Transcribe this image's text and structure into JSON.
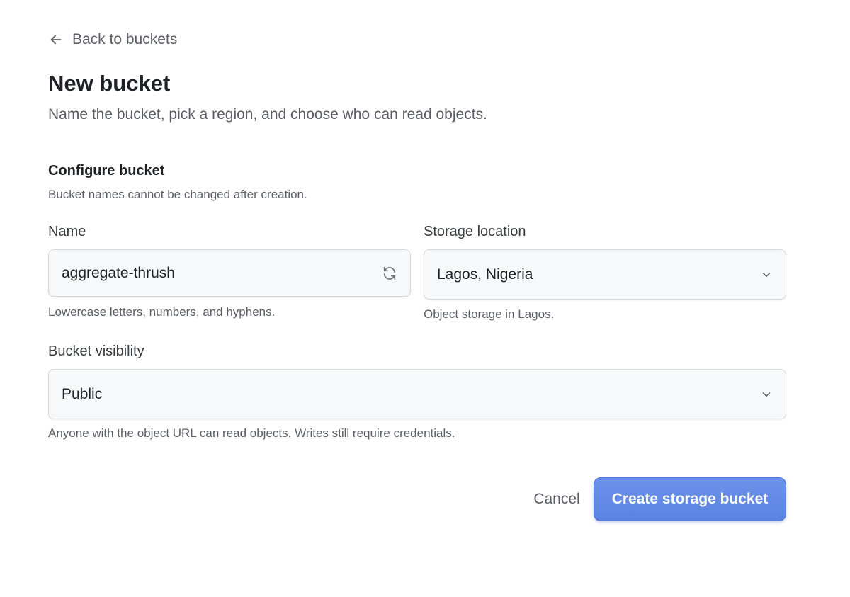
{
  "nav": {
    "back_label": "Back to buckets"
  },
  "header": {
    "title": "New bucket",
    "subtitle": "Name the bucket, pick a region, and choose who can read objects."
  },
  "section": {
    "title": "Configure bucket",
    "description": "Bucket names cannot be changed after creation."
  },
  "fields": {
    "name": {
      "label": "Name",
      "value": "aggregate-thrush",
      "helper": "Lowercase letters, numbers, and hyphens.",
      "icon": "refresh-icon"
    },
    "location": {
      "label": "Storage location",
      "value": "Lagos, Nigeria",
      "helper": "Object storage in Lagos.",
      "icon": "chevron-down-icon"
    },
    "visibility": {
      "label": "Bucket visibility",
      "value": "Public",
      "helper": "Anyone with the object URL can read objects. Writes still require credentials.",
      "icon": "chevron-down-icon"
    }
  },
  "actions": {
    "cancel_label": "Cancel",
    "create_label": "Create storage bucket"
  },
  "colors": {
    "primary": "#5a82e2",
    "text": "#1f2126",
    "muted": "#5b5e66",
    "field_bg": "#f7f8fa",
    "border": "#d6d8dd"
  }
}
